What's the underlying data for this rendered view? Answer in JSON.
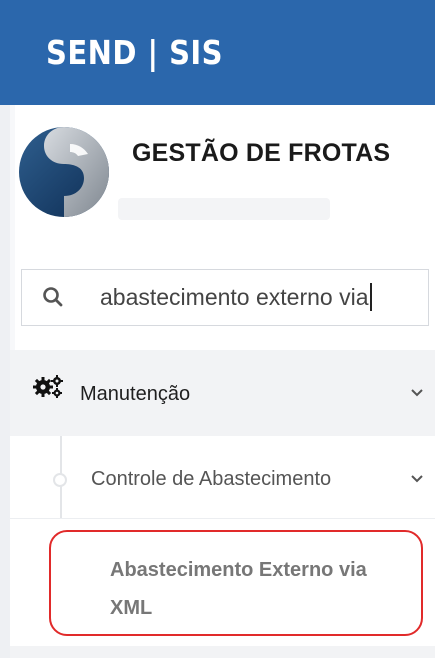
{
  "header": {
    "brand": "SEND | SIS"
  },
  "app": {
    "title": "GESTÃO DE FROTAS"
  },
  "search": {
    "value": "abastecimento externo via",
    "icon": "search-icon"
  },
  "menu": {
    "section": {
      "label": "Manutenção",
      "icon": "gears-icon"
    },
    "submenu": {
      "label": "Controle de Abastecimento"
    },
    "item": {
      "label": "Abastecimento Externo via XML"
    }
  },
  "colors": {
    "header": "#2b67ac",
    "highlight": "#e12a2a"
  }
}
